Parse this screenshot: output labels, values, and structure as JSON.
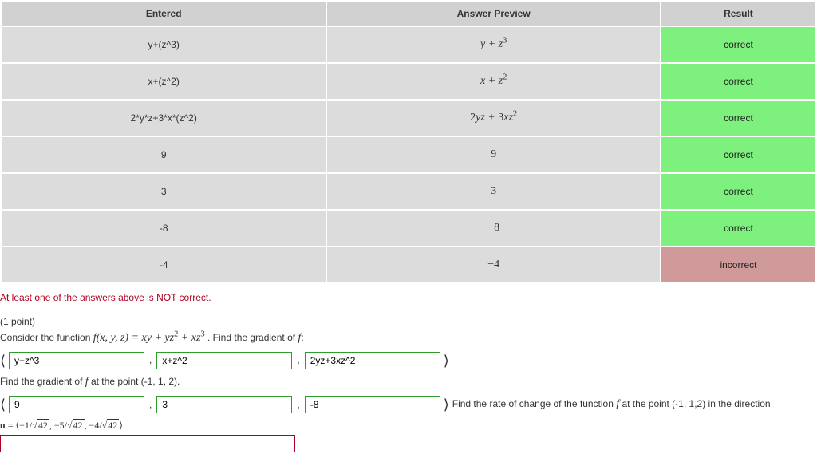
{
  "columns": {
    "entered": "Entered",
    "preview": "Answer Preview",
    "result": "Result"
  },
  "rows": [
    {
      "entered": "y+(z^3)",
      "preview_html": "<span class='math'>y + z<sup>3</sup></span>",
      "result": "correct",
      "status": "correct"
    },
    {
      "entered": "x+(z^2)",
      "preview_html": "<span class='math'>x + z<sup>2</sup></span>",
      "result": "correct",
      "status": "correct"
    },
    {
      "entered": "2*y*z+3*x*(z^2)",
      "preview_html": "<span class='math'><span class='rm'>2</span>yz + <span class='rm'>3</span>xz<sup>2</sup></span>",
      "result": "correct",
      "status": "correct"
    },
    {
      "entered": "9",
      "preview_html": "<span class='math'><span class='rm'>9</span></span>",
      "result": "correct",
      "status": "correct"
    },
    {
      "entered": "3",
      "preview_html": "<span class='math'><span class='rm'>3</span></span>",
      "result": "correct",
      "status": "correct"
    },
    {
      "entered": "-8",
      "preview_html": "<span class='math'><span class='rm'>−8</span></span>",
      "result": "correct",
      "status": "correct"
    },
    {
      "entered": "-4",
      "preview_html": "<span class='math'><span class='rm'>−4</span></span>",
      "result": "incorrect",
      "status": "incorrect"
    }
  ],
  "warning": "At least one of the answers above is NOT correct.",
  "problem": {
    "points": "(1 point)",
    "line1_prefix": "Consider the function ",
    "line1_func_html": "<span class='math'>f(x, y, z) = xy + yz<sup>2</sup> + xz<sup>3</sup></span>",
    "line1_suffix": ". Find the gradient of ",
    "line1_f": "f",
    "colon": ":",
    "grad_inputs": {
      "a": "y+z^3",
      "b": "x+z^2",
      "c": "2yz+3xz^2"
    },
    "line2_prefix": "Find the gradient of ",
    "line2_f": "f",
    "line2_suffix": " at the point (-1, 1, 2).",
    "point_inputs": {
      "a": "9",
      "b": "3",
      "c": "-8"
    },
    "rate_text_prefix": "Find the rate of change of the function ",
    "rate_text_f": "f",
    "rate_text_suffix": " at the point (-1, 1,2) in the direction",
    "u_html": "<span class='bold-u'><b>u</b> = ⟨−1/<span class='sqrt'>√<span class='rad'>42</span></span>, −5/<span class='sqrt'>√<span class='rad'>42</span></span>, −4/<span class='sqrt'>√<span class='rad'>42</span></span>⟩.</span>",
    "rate_input": ""
  },
  "glyphs": {
    "lang": "⟨",
    "rang": "⟩"
  }
}
